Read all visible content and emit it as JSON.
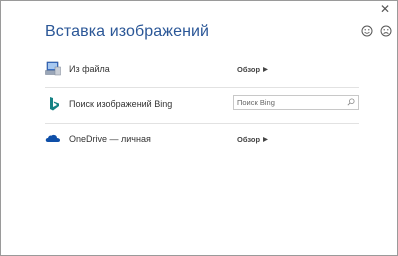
{
  "dialog": {
    "title": "Вставка изображений",
    "close_glyph": "✕"
  },
  "feedback": {
    "happy_icon": "smile-icon",
    "sad_icon": "frown-icon"
  },
  "sources": [
    {
      "label": "Из файла",
      "icon": "computer-icon",
      "action_label": "Обзор"
    },
    {
      "label": "Поиск изображений Bing",
      "icon": "bing-icon",
      "search_placeholder": "Поиск Bing"
    },
    {
      "label": "OneDrive — личная",
      "icon": "onedrive-icon",
      "action_label": "Обзор"
    }
  ],
  "colors": {
    "title": "#2b5797",
    "bing": "#158284",
    "onedrive": "#0f4fa8"
  }
}
